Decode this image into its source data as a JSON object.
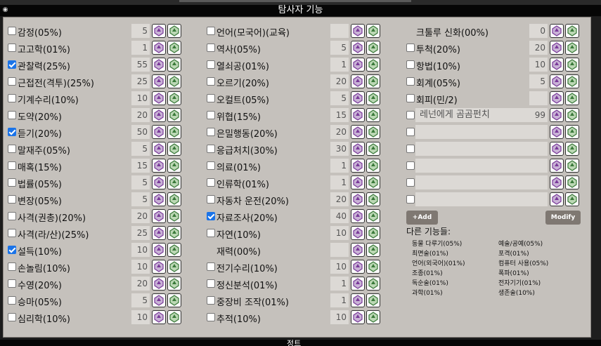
{
  "header": {
    "title": "탐사자 기능"
  },
  "footer": {
    "title": "정트"
  },
  "columns": [
    [
      {
        "label": "감정(05%)",
        "value": "5",
        "checked": false,
        "has_checkbox": true
      },
      {
        "label": "고고학(01%)",
        "value": "1",
        "checked": false,
        "has_checkbox": true
      },
      {
        "label": "관찰력(25%)",
        "value": "55",
        "checked": true,
        "has_checkbox": true
      },
      {
        "label": "근접전(격투)(25%)",
        "value": "25",
        "checked": false,
        "has_checkbox": true
      },
      {
        "label": "기계수리(10%)",
        "value": "10",
        "checked": false,
        "has_checkbox": true
      },
      {
        "label": "도약(20%)",
        "value": "20",
        "checked": false,
        "has_checkbox": true
      },
      {
        "label": "듣기(20%)",
        "value": "50",
        "checked": true,
        "has_checkbox": true
      },
      {
        "label": "말재주(05%)",
        "value": "5",
        "checked": false,
        "has_checkbox": true
      },
      {
        "label": "매혹(15%)",
        "value": "15",
        "checked": false,
        "has_checkbox": true
      },
      {
        "label": "법률(05%)",
        "value": "5",
        "checked": false,
        "has_checkbox": true
      },
      {
        "label": "변장(05%)",
        "value": "5",
        "checked": false,
        "has_checkbox": true
      },
      {
        "label": "사격(권총)(20%)",
        "value": "20",
        "checked": false,
        "has_checkbox": true
      },
      {
        "label": "사격(라/산)(25%)",
        "value": "25",
        "checked": false,
        "has_checkbox": true
      },
      {
        "label": "설득(10%)",
        "value": "10",
        "checked": true,
        "has_checkbox": true
      },
      {
        "label": "손놀림(10%)",
        "value": "10",
        "checked": false,
        "has_checkbox": true
      },
      {
        "label": "수영(20%)",
        "value": "20",
        "checked": false,
        "has_checkbox": true
      },
      {
        "label": "승마(05%)",
        "value": "5",
        "checked": false,
        "has_checkbox": true
      },
      {
        "label": "심리학(10%)",
        "value": "10",
        "checked": false,
        "has_checkbox": true
      }
    ],
    [
      {
        "label": "언어(모국어)(교육)",
        "value": "",
        "checked": false,
        "has_checkbox": true
      },
      {
        "label": "역사(05%)",
        "value": "5",
        "checked": false,
        "has_checkbox": true
      },
      {
        "label": "열쇠공(01%)",
        "value": "1",
        "checked": false,
        "has_checkbox": true
      },
      {
        "label": "오르기(20%)",
        "value": "20",
        "checked": false,
        "has_checkbox": true
      },
      {
        "label": "오컬트(05%)",
        "value": "5",
        "checked": false,
        "has_checkbox": true
      },
      {
        "label": "위협(15%)",
        "value": "15",
        "checked": false,
        "has_checkbox": true
      },
      {
        "label": "은밀행동(20%)",
        "value": "20",
        "checked": false,
        "has_checkbox": true
      },
      {
        "label": "응급처치(30%)",
        "value": "30",
        "checked": false,
        "has_checkbox": true
      },
      {
        "label": "의료(01%)",
        "value": "1",
        "checked": false,
        "has_checkbox": true
      },
      {
        "label": "인류학(01%)",
        "value": "1",
        "checked": false,
        "has_checkbox": true
      },
      {
        "label": "자동차 운전(20%)",
        "value": "20",
        "checked": false,
        "has_checkbox": true
      },
      {
        "label": "자료조사(20%)",
        "value": "40",
        "checked": true,
        "has_checkbox": true
      },
      {
        "label": "자연(10%)",
        "value": "10",
        "checked": false,
        "has_checkbox": true
      },
      {
        "label": "재력(00%)",
        "value": "",
        "checked": false,
        "has_checkbox": false
      },
      {
        "label": "전기수리(10%)",
        "value": "10",
        "checked": false,
        "has_checkbox": true
      },
      {
        "label": "정신분석(01%)",
        "value": "1",
        "checked": false,
        "has_checkbox": true
      },
      {
        "label": "중장비 조작(01%)",
        "value": "1",
        "checked": false,
        "has_checkbox": true
      },
      {
        "label": "추적(10%)",
        "value": "10",
        "checked": false,
        "has_checkbox": true
      }
    ],
    [
      {
        "label": "크툴루 신화(00%)",
        "value": "0",
        "checked": false,
        "has_checkbox": false
      },
      {
        "label": "투척(20%)",
        "value": "20",
        "checked": false,
        "has_checkbox": true
      },
      {
        "label": "항법(10%)",
        "value": "10",
        "checked": false,
        "has_checkbox": true
      },
      {
        "label": "회계(05%)",
        "value": "5",
        "checked": false,
        "has_checkbox": true
      },
      {
        "label": "회피(민/2)",
        "value": "",
        "checked": false,
        "has_checkbox": true
      }
    ]
  ],
  "custom_skills": [
    {
      "label": "레넌에게 곰곰펀치",
      "value": "99"
    },
    {
      "label": "",
      "value": ""
    },
    {
      "label": "",
      "value": ""
    },
    {
      "label": "",
      "value": ""
    },
    {
      "label": "",
      "value": ""
    },
    {
      "label": "",
      "value": ""
    }
  ],
  "buttons": {
    "add": "+Add",
    "modify": "Modify"
  },
  "other_skills": {
    "title": "다른 기능들:",
    "left": [
      "동물 다루기(05%)",
      "최면술(01%)",
      "언어(외국어)(01%)",
      "조종(01%)",
      "독순술(01%)",
      "과학(01%)"
    ],
    "right": [
      "예술/공예(05%)",
      "포격(01%)",
      "컴퓨터 사용(05%)",
      "폭파(01%)",
      "전자기기(01%)",
      "생존술(10%)"
    ]
  },
  "icons": {
    "dice_a": "purple-die-icon",
    "dice_b": "green-die-icon"
  },
  "colors": {
    "panel": "#c5c1bc",
    "header": "#060606",
    "die_a": "#7a3a9a",
    "die_b": "#3a7a3a",
    "check": "#1a73e8"
  }
}
